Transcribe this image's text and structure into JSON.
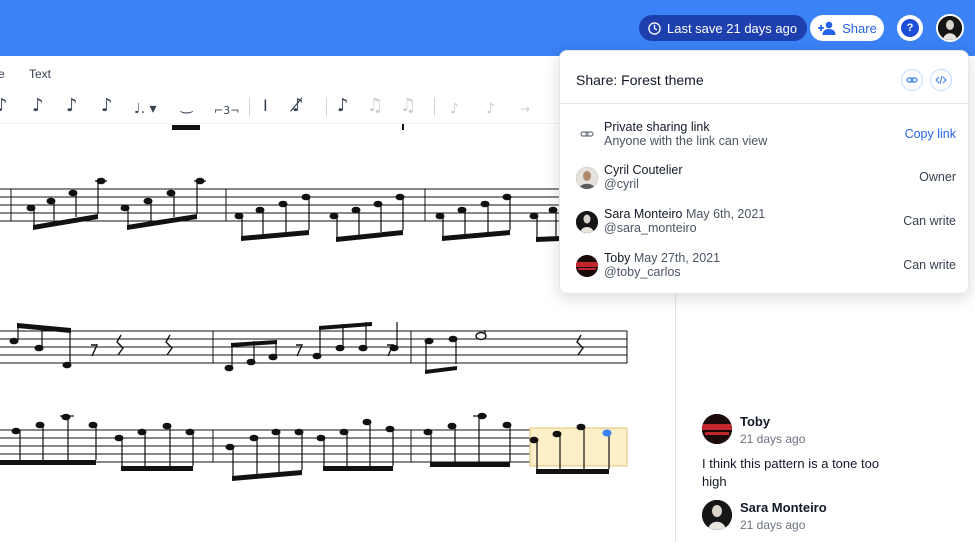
{
  "topbar": {
    "last_save": "Last save 21 days ago",
    "share_label": "Share"
  },
  "menubar": {
    "items": [
      "e",
      "Text"
    ]
  },
  "share_panel": {
    "title": "Share: Forest theme",
    "private_link_title": "Private sharing link",
    "private_link_sub": "Anyone with the link can view",
    "copy_link": "Copy link",
    "members": [
      {
        "name": "Cyril Coutelier",
        "date": "",
        "handle": "@cyril",
        "role": "Owner"
      },
      {
        "name": "Sara Monteiro",
        "date": "May 6th, 2021",
        "handle": "@sara_monteiro",
        "role": "Can write"
      },
      {
        "name": "Toby",
        "date": "May 27th, 2021",
        "handle": "@toby_carlos",
        "role": "Can write"
      }
    ]
  },
  "comments": [
    {
      "author": "Toby",
      "time": "21 days ago",
      "text": "I think this pattern is a tone too high"
    },
    {
      "author": "Sara Monteiro",
      "time": "21 days ago",
      "text": ""
    }
  ],
  "colors": {
    "accent": "#3b82f6",
    "save_pill": "#1e40af",
    "selection": "#fdf0c8"
  }
}
